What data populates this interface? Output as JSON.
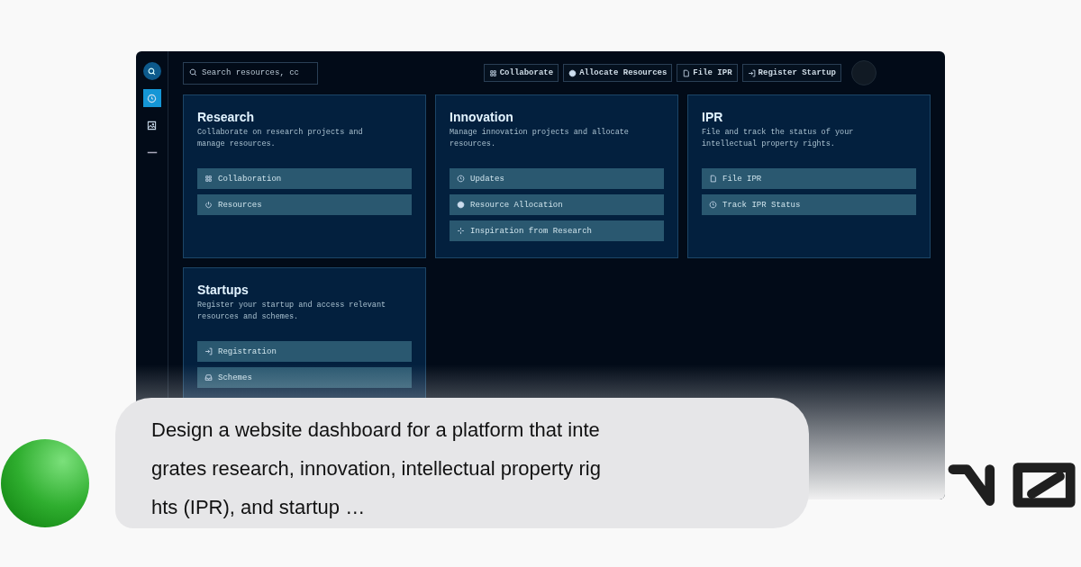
{
  "sidebar": {
    "items": [
      {
        "kind": "brand",
        "selected": false
      },
      {
        "kind": "clock",
        "selected": true
      },
      {
        "kind": "image",
        "selected": false
      },
      {
        "kind": "dash",
        "selected": false
      }
    ]
  },
  "search": {
    "placeholder": "Search resources, cc"
  },
  "actions": [
    {
      "kind": "grid",
      "label": "Collaborate"
    },
    {
      "kind": "disc",
      "label": "Allocate Resources"
    },
    {
      "kind": "document",
      "label": "File IPR"
    },
    {
      "kind": "login",
      "label": "Register Startup"
    }
  ],
  "cards": [
    {
      "title": "Research",
      "description": "Collaborate on research projects and manage resources.",
      "items": [
        {
          "kind": "grid",
          "label": "Collaboration"
        },
        {
          "kind": "power",
          "label": "Resources"
        }
      ]
    },
    {
      "title": "Innovation",
      "description": "Manage innovation projects and allocate resources.",
      "items": [
        {
          "kind": "clock",
          "label": "Updates"
        },
        {
          "kind": "disc",
          "label": "Resource Allocation"
        },
        {
          "kind": "sparkle",
          "label": "Inspiration from Research"
        }
      ]
    },
    {
      "title": "IPR",
      "description": "File and track the status of your intellectual property rights.",
      "items": [
        {
          "kind": "document",
          "label": "File IPR"
        },
        {
          "kind": "clock",
          "label": "Track IPR Status"
        }
      ]
    },
    {
      "title": "Startups",
      "description": "Register your startup and access relevant resources and schemes.",
      "items": [
        {
          "kind": "login",
          "label": "Registration"
        },
        {
          "kind": "tray",
          "label": "Schemes"
        }
      ]
    }
  ],
  "prompt": {
    "lines": [
      "Design a website dashboard for a platform that inte",
      "grates research, innovation, intellectual property rig",
      "hts (IPR), and startup …"
    ]
  }
}
